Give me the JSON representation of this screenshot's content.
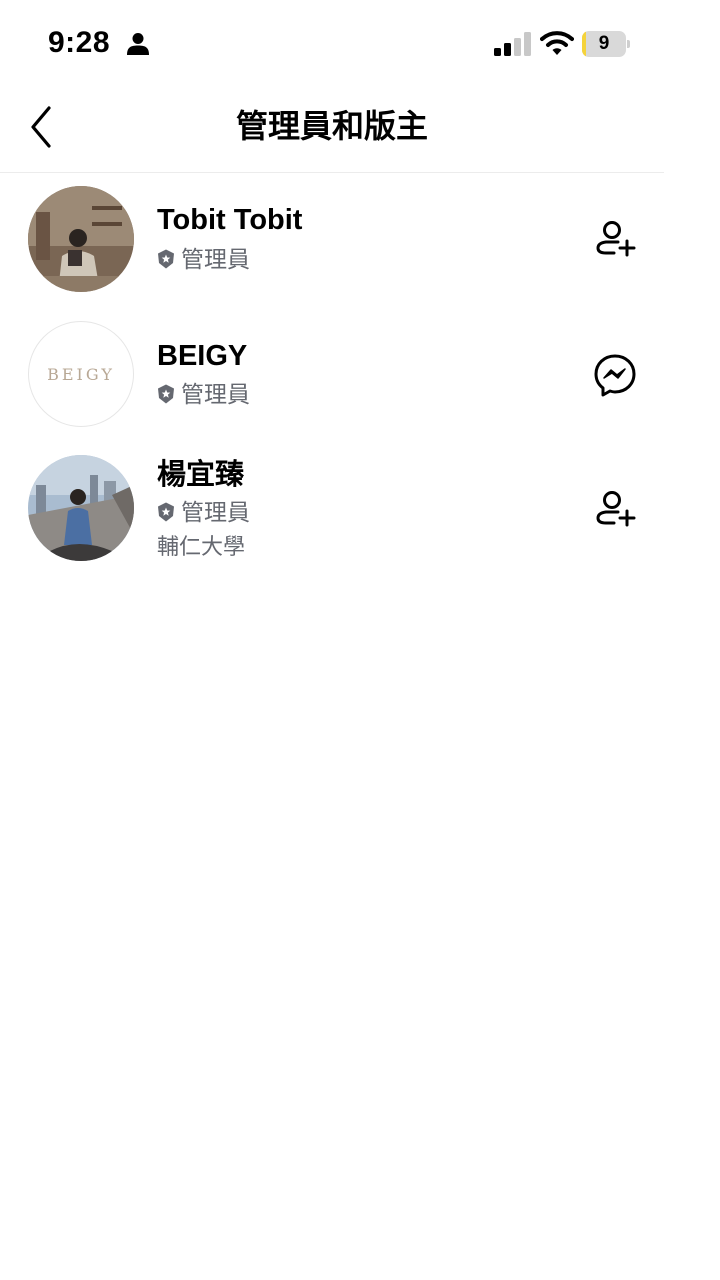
{
  "status_bar": {
    "time": "9:28",
    "battery": "9",
    "battery_level": 0.09,
    "icons": [
      "person-icon",
      "signal-icon",
      "wifi-icon",
      "battery-icon"
    ]
  },
  "header": {
    "title": "管理員和版主",
    "back_icon": "chevron-left-icon"
  },
  "members": [
    {
      "name": "Tobit Tobit",
      "role": "管理員",
      "action_icon": "add-friend-icon"
    },
    {
      "name": "BEIGY",
      "avatar_text": "BEIGY",
      "role": "管理員",
      "action_icon": "messenger-icon"
    },
    {
      "name": "楊宜臻",
      "role": "管理員",
      "school": "輔仁大學",
      "action_icon": "add-friend-icon"
    }
  ],
  "colors": {
    "text": "#000000",
    "secondary": "#656870",
    "divider": "#ececec",
    "battery_fill": "#f5d33b"
  }
}
